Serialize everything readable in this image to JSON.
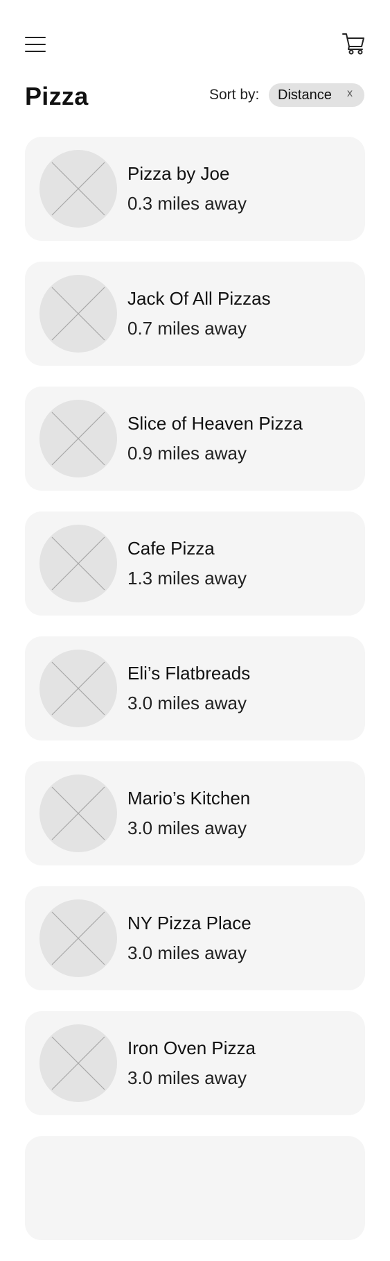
{
  "header": {
    "menu_icon": "hamburger-menu-icon",
    "cart_icon": "shopping-cart-icon"
  },
  "page": {
    "title": "Pizza"
  },
  "sort": {
    "label": "Sort by:",
    "selected": "Distance",
    "clear_label": "x"
  },
  "restaurants": [
    {
      "name": "Pizza by Joe",
      "distance": "0.3 miles away",
      "image_icon": "image-placeholder-icon"
    },
    {
      "name": "Jack Of All Pizzas",
      "distance": "0.7 miles away",
      "image_icon": "image-placeholder-icon"
    },
    {
      "name": "Slice of Heaven Pizza",
      "distance": "0.9 miles away",
      "image_icon": "image-placeholder-icon"
    },
    {
      "name": "Cafe Pizza",
      "distance": "1.3 miles away",
      "image_icon": "image-placeholder-icon"
    },
    {
      "name": "Eli’s Flatbreads",
      "distance": "3.0 miles away",
      "image_icon": "image-placeholder-icon"
    },
    {
      "name": "Mario’s Kitchen",
      "distance": "3.0 miles away",
      "image_icon": "image-placeholder-icon"
    },
    {
      "name": "NY Pizza Place",
      "distance": "3.0 miles away",
      "image_icon": "image-placeholder-icon"
    },
    {
      "name": "Iron Oven Pizza",
      "distance": "3.0 miles away",
      "image_icon": "image-placeholder-icon"
    }
  ]
}
